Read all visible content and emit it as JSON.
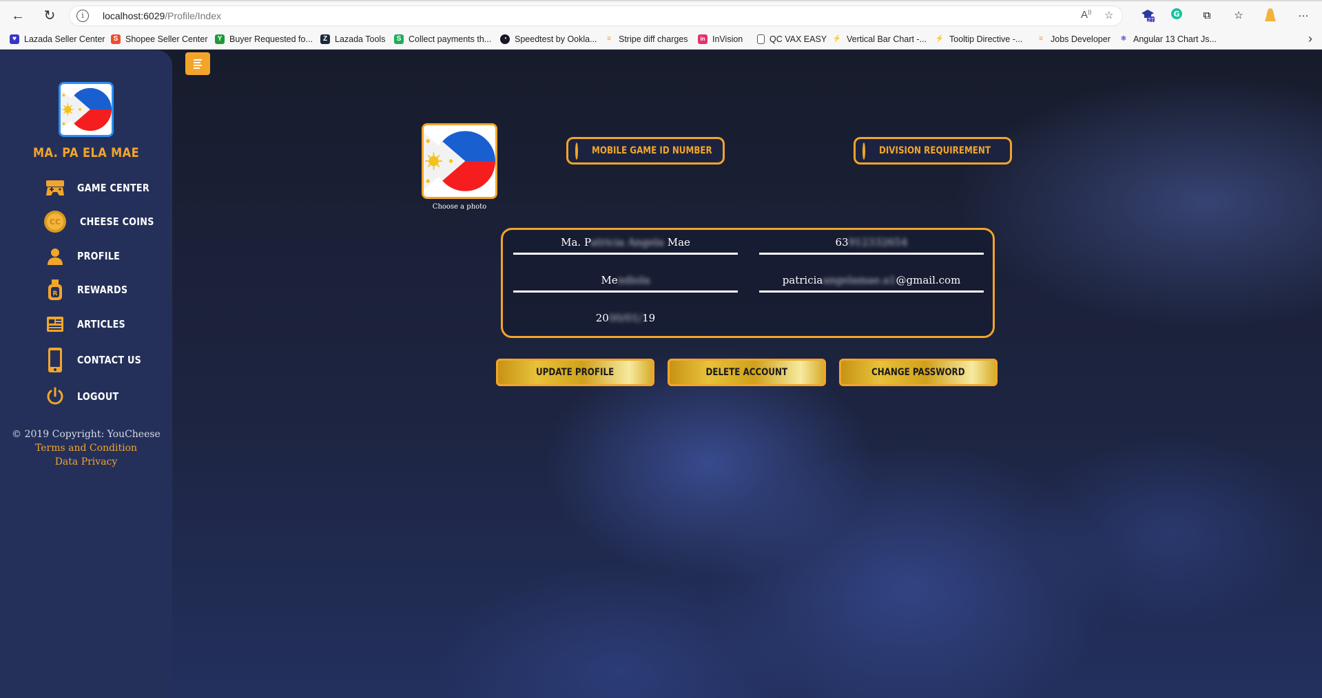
{
  "browser": {
    "url_host": "localhost:6029",
    "url_path": "/Profile/Index",
    "ext_badge": "27"
  },
  "bookmarks": [
    {
      "label": "Lazada Seller Center",
      "color": "#3a35c7",
      "glyph": "♥"
    },
    {
      "label": "Shopee Seller Center",
      "color": "#ee4d2d",
      "glyph": "S"
    },
    {
      "label": "Buyer Requested fo...",
      "color": "#1d9a3a",
      "glyph": "Y"
    },
    {
      "label": "Lazada Tools",
      "color": "#1b2a3a",
      "glyph": "Z"
    },
    {
      "label": "Collect payments th...",
      "color": "#1fae5a",
      "glyph": "S"
    },
    {
      "label": "Speedtest by Ookla...",
      "color": "#141526",
      "glyph": "◔"
    },
    {
      "label": "Stripe diff charges",
      "color": "#e8a02a",
      "glyph": "≡"
    },
    {
      "label": "InVision",
      "color": "#e5336a",
      "glyph": "in"
    },
    {
      "label": "QC VAX EASY",
      "color": "#ffffff",
      "glyph": "▯"
    },
    {
      "label": "Vertical Bar Chart -...",
      "color": "#1e88e5",
      "glyph": "⚡"
    },
    {
      "label": "Tooltip Directive -...",
      "color": "#1e88e5",
      "glyph": "⚡"
    },
    {
      "label": "Jobs Developer",
      "color": "#e8a02a",
      "glyph": "≡"
    },
    {
      "label": "Angular 13 Chart Js...",
      "color": "#5a4fcf",
      "glyph": "⚛"
    }
  ],
  "sidebar": {
    "user_name": "MA. PA          ELA MAE",
    "menu": [
      {
        "label": "GAME CENTER",
        "icon": "gamepad-icon"
      },
      {
        "label": "CHEESE COINS",
        "icon": "coin-icon"
      },
      {
        "label": "PROFILE",
        "icon": "profile-icon"
      },
      {
        "label": "REWARDS",
        "icon": "medal-icon"
      },
      {
        "label": "ARTICLES",
        "icon": "newspaper-icon"
      },
      {
        "label": "CONTACT US",
        "icon": "phone-icon"
      },
      {
        "label": "LOGOUT",
        "icon": "power-icon"
      }
    ],
    "copyright": "© 2019 Copyright: YouCheese",
    "terms": "Terms and Condition",
    "privacy": "Data Privacy"
  },
  "profile": {
    "choose_photo": "Choose a photo",
    "mobile_game_btn": "MOBILE GAME ID NUMBER",
    "division_btn": "DIVISION REQUIREMENT",
    "fields": {
      "name_start": "Ma. P",
      "name_hidden": "atricia Angela",
      "name_end": " Mae",
      "phone_start": "63",
      "phone_hidden": "9123",
      "phone_end": "32654",
      "city_start": "Me",
      "city_hidden": "ndiola",
      "city_end": "",
      "email_start": "patricia",
      "email_hidden": "angelamae.a1",
      "email_end": "@gmail.com",
      "date_start": "20",
      "date_hidden": "00/01/",
      "date_end": "19"
    },
    "update_btn": "UPDATE PROFILE",
    "delete_btn": "DELETE ACCOUNT",
    "password_btn": "CHANGE PASSWORD"
  },
  "colors": {
    "accent": "#f3a52a",
    "sidebar": "#24305a",
    "background": "#1b2136"
  }
}
